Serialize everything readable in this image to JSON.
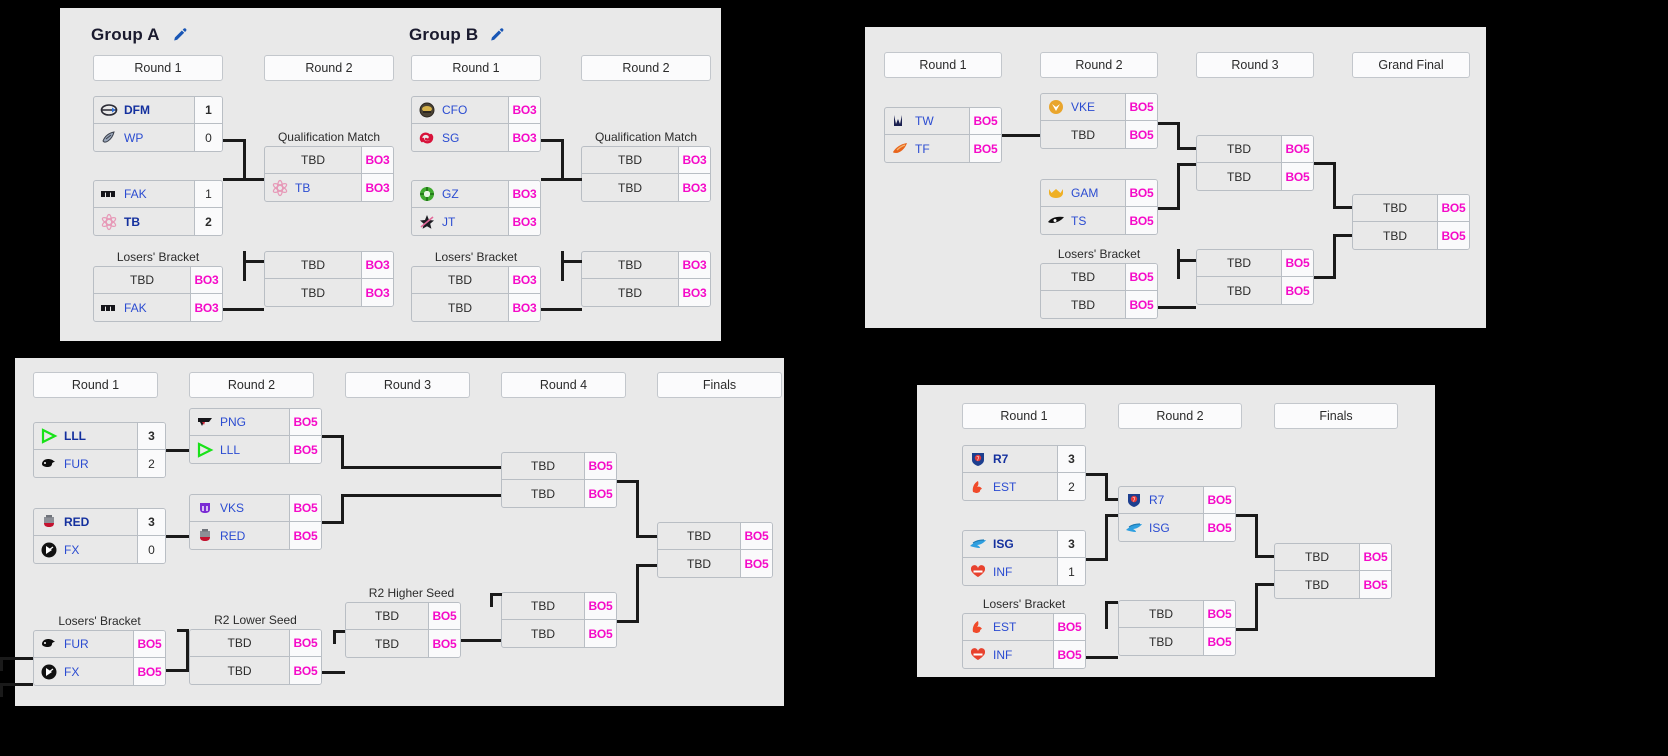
{
  "colors": {
    "panel_bg": "#e9e9e9",
    "page_bg": "#000000",
    "team_name": "#2b4cd1",
    "bo_label": "#f50ac8",
    "line": "#1a1a1a",
    "border": "#b9bec4"
  },
  "labels": {
    "tbd": "TBD",
    "bo3": "BO3",
    "bo5": "BO5",
    "losers_bracket": "Losers' Bracket",
    "qualification_match": "Qualification Match",
    "r2_lower_seed": "R2 Lower Seed",
    "r2_higher_seed": "R2 Higher Seed",
    "round1": "Round 1",
    "round2": "Round 2",
    "round3": "Round 3",
    "round4": "Round 4",
    "finals": "Finals",
    "grand_final": "Grand Final"
  },
  "panel_groups": {
    "group_a": {
      "title": "Group A",
      "edit_icon": "pencil-icon",
      "rounds": [
        "Round 1",
        "Round 2"
      ],
      "r1_m1": {
        "top": {
          "team": "DFM",
          "logo": "dfm-logo",
          "score": "1",
          "winner": true
        },
        "bot": {
          "team": "WP",
          "logo": "wp-logo",
          "score": "0",
          "winner": false
        }
      },
      "r1_m2": {
        "top": {
          "team": "FAK",
          "logo": "fak-logo",
          "score": "1",
          "winner": false
        },
        "bot": {
          "team": "TB",
          "logo": "tb-logo",
          "score": "2",
          "winner": true
        }
      },
      "lb_label": "Losers' Bracket",
      "lb_m1": {
        "top": {
          "team": "TBD",
          "logo": null,
          "score": "BO3"
        },
        "bot": {
          "team": "FAK",
          "logo": "fak-logo",
          "score": "BO3"
        }
      },
      "qual_label": "Qualification Match",
      "r2_m1": {
        "top": {
          "team": "TBD",
          "logo": null,
          "score": "BO3"
        },
        "bot": {
          "team": "TB",
          "logo": "tb-logo",
          "score": "BO3"
        }
      },
      "r2_m2": {
        "top": {
          "team": "TBD",
          "logo": null,
          "score": "BO3"
        },
        "bot": {
          "team": "TBD",
          "logo": null,
          "score": "BO3"
        }
      }
    },
    "group_b": {
      "title": "Group B",
      "edit_icon": "pencil-icon",
      "rounds": [
        "Round 1",
        "Round 2"
      ],
      "r1_m1": {
        "top": {
          "team": "CFO",
          "logo": "cfo-logo",
          "score": "BO3"
        },
        "bot": {
          "team": "SG",
          "logo": "sg-logo",
          "score": "BO3"
        }
      },
      "r1_m2": {
        "top": {
          "team": "GZ",
          "logo": "gz-logo",
          "score": "BO3"
        },
        "bot": {
          "team": "JT",
          "logo": "jt-logo",
          "score": "BO3"
        }
      },
      "lb_label": "Losers' Bracket",
      "lb_m1": {
        "top": {
          "team": "TBD",
          "logo": null,
          "score": "BO3"
        },
        "bot": {
          "team": "TBD",
          "logo": null,
          "score": "BO3"
        }
      },
      "qual_label": "Qualification Match",
      "r2_m1": {
        "top": {
          "team": "TBD",
          "logo": null,
          "score": "BO3"
        },
        "bot": {
          "team": "TBD",
          "logo": null,
          "score": "BO3"
        }
      },
      "r2_m2": {
        "top": {
          "team": "TBD",
          "logo": null,
          "score": "BO3"
        },
        "bot": {
          "team": "TBD",
          "logo": null,
          "score": "BO3"
        }
      }
    }
  },
  "panel_top_right": {
    "rounds": [
      "Round 1",
      "Round 2",
      "Round 3",
      "Grand Final"
    ],
    "r1_m1": {
      "top": {
        "team": "TW",
        "logo": "tw-logo",
        "score": "BO5"
      },
      "bot": {
        "team": "TF",
        "logo": "tf-logo",
        "score": "BO5"
      }
    },
    "r2_m1": {
      "top": {
        "team": "VKE",
        "logo": "vke-logo",
        "score": "BO5"
      },
      "bot": {
        "team": "TBD",
        "logo": null,
        "score": "BO5"
      }
    },
    "r2_m2": {
      "top": {
        "team": "GAM",
        "logo": "gam-logo",
        "score": "BO5"
      },
      "bot": {
        "team": "TS",
        "logo": "ts-logo",
        "score": "BO5"
      }
    },
    "lb_label": "Losers' Bracket",
    "lb_m1": {
      "top": {
        "team": "TBD",
        "logo": null,
        "score": "BO5"
      },
      "bot": {
        "team": "TBD",
        "logo": null,
        "score": "BO5"
      }
    },
    "r3_m1": {
      "top": {
        "team": "TBD",
        "logo": null,
        "score": "BO5"
      },
      "bot": {
        "team": "TBD",
        "logo": null,
        "score": "BO5"
      }
    },
    "r3_m2": {
      "top": {
        "team": "TBD",
        "logo": null,
        "score": "BO5"
      },
      "bot": {
        "team": "TBD",
        "logo": null,
        "score": "BO5"
      }
    },
    "gf_m1": {
      "top": {
        "team": "TBD",
        "logo": null,
        "score": "BO5"
      },
      "bot": {
        "team": "TBD",
        "logo": null,
        "score": "BO5"
      }
    }
  },
  "panel_bottom_left": {
    "rounds": [
      "Round 1",
      "Round 2",
      "Round 3",
      "Round 4",
      "Finals"
    ],
    "r1_m1": {
      "top": {
        "team": "LLL",
        "logo": "lll-logo",
        "score": "3",
        "winner": true
      },
      "bot": {
        "team": "FUR",
        "logo": "fur-logo",
        "score": "2",
        "winner": false
      }
    },
    "r1_m2": {
      "top": {
        "team": "RED",
        "logo": "red-logo",
        "score": "3",
        "winner": true
      },
      "bot": {
        "team": "FX",
        "logo": "fx-logo",
        "score": "0",
        "winner": false
      }
    },
    "lb_label": "Losers' Bracket",
    "lb_m1": {
      "top": {
        "team": "FUR",
        "logo": "fur-logo",
        "score": "BO5"
      },
      "bot": {
        "team": "FX",
        "logo": "fx-logo",
        "score": "BO5"
      }
    },
    "r2_m1": {
      "top": {
        "team": "PNG",
        "logo": "png-logo",
        "score": "BO5"
      },
      "bot": {
        "team": "LLL",
        "logo": "lll-logo",
        "score": "BO5"
      }
    },
    "r2_m2": {
      "top": {
        "team": "VKS",
        "logo": "vks-logo",
        "score": "BO5"
      },
      "bot": {
        "team": "RED",
        "logo": "red-logo",
        "score": "BO5"
      }
    },
    "r2_lower_label": "R2 Lower Seed",
    "r2_lower": {
      "top": {
        "team": "TBD",
        "logo": null,
        "score": "BO5"
      },
      "bot": {
        "team": "TBD",
        "logo": null,
        "score": "BO5"
      }
    },
    "r3_higher_label": "R2 Higher Seed",
    "r3_higher": {
      "top": {
        "team": "TBD",
        "logo": null,
        "score": "BO5"
      },
      "bot": {
        "team": "TBD",
        "logo": null,
        "score": "BO5"
      }
    },
    "r3_m1": {
      "top": {
        "team": "TBD",
        "logo": null,
        "score": "BO5"
      },
      "bot": {
        "team": "TBD",
        "logo": null,
        "score": "BO5"
      }
    },
    "r4_m1": {
      "top": {
        "team": "TBD",
        "logo": null,
        "score": "BO5"
      },
      "bot": {
        "team": "TBD",
        "logo": null,
        "score": "BO5"
      }
    },
    "r4_m2": {
      "top": {
        "team": "TBD",
        "logo": null,
        "score": "BO5"
      },
      "bot": {
        "team": "TBD",
        "logo": null,
        "score": "BO5"
      }
    },
    "finals_m1": {
      "top": {
        "team": "TBD",
        "logo": null,
        "score": "BO5"
      },
      "bot": {
        "team": "TBD",
        "logo": null,
        "score": "BO5"
      }
    }
  },
  "panel_bottom_right": {
    "rounds": [
      "Round 1",
      "Round 2",
      "Finals"
    ],
    "r1_m1": {
      "top": {
        "team": "R7",
        "logo": "r7-logo",
        "score": "3",
        "winner": true
      },
      "bot": {
        "team": "EST",
        "logo": "est-logo",
        "score": "2",
        "winner": false
      }
    },
    "r1_m2": {
      "top": {
        "team": "ISG",
        "logo": "isg-logo",
        "score": "3",
        "winner": true
      },
      "bot": {
        "team": "INF",
        "logo": "inf-logo",
        "score": "1",
        "winner": false
      }
    },
    "lb_label": "Losers' Bracket",
    "lb_m1": {
      "top": {
        "team": "EST",
        "logo": "est-logo",
        "score": "BO5"
      },
      "bot": {
        "team": "INF",
        "logo": "inf-logo",
        "score": "BO5"
      }
    },
    "r2_m1": {
      "top": {
        "team": "R7",
        "logo": "r7-logo",
        "score": "BO5"
      },
      "bot": {
        "team": "ISG",
        "logo": "isg-logo",
        "score": "BO5"
      }
    },
    "r2_m2": {
      "top": {
        "team": "TBD",
        "logo": null,
        "score": "BO5"
      },
      "bot": {
        "team": "TBD",
        "logo": null,
        "score": "BO5"
      }
    },
    "finals_m1": {
      "top": {
        "team": "TBD",
        "logo": null,
        "score": "BO5"
      },
      "bot": {
        "team": "TBD",
        "logo": null,
        "score": "BO5"
      }
    }
  }
}
